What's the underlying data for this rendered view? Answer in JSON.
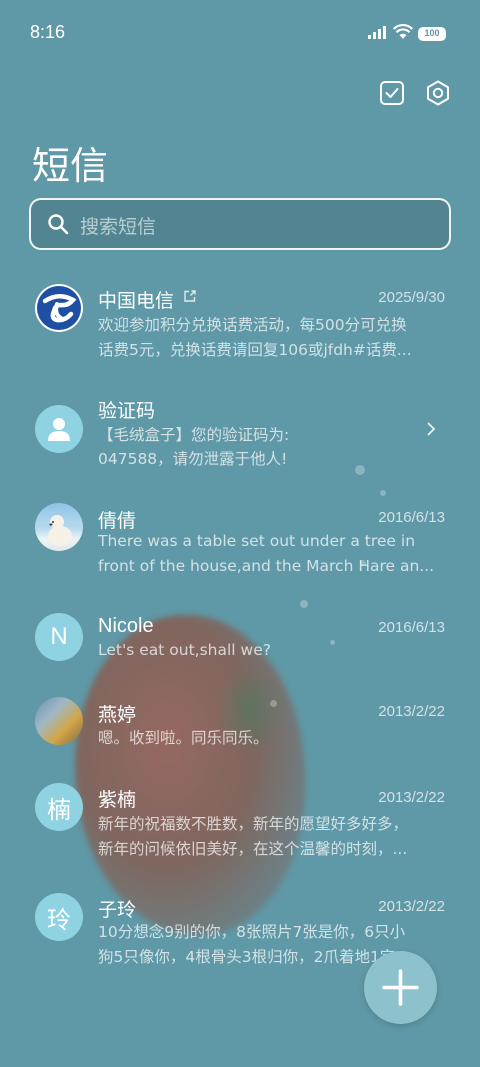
{
  "status_bar": {
    "time": "8:16",
    "battery": "100"
  },
  "header": {
    "title": "短信"
  },
  "search": {
    "placeholder": "搜索短信"
  },
  "conversations": [
    {
      "name": "中国电信",
      "date": "2025/9/30",
      "line1": "欢迎参加积分兑换话费活动，每500分可兑换",
      "line2": "话费5元，兑换话费请回复106或jfdh#话费..."
    },
    {
      "name": "验证码",
      "date": "",
      "line1": "【毛绒盒子】您的验证码为:",
      "line2": "047588，请勿泄露于他人!"
    },
    {
      "name": "倩倩",
      "date": "2016/6/13",
      "line1": "There was a table set out under a tree in",
      "line2": "front of the house,and the March Hare an..."
    },
    {
      "name": "Nicole",
      "avatar_letter": "N",
      "date": "2016/6/13",
      "line1": "Let's eat out,shall we?"
    },
    {
      "name": "燕婷",
      "date": "2013/2/22",
      "line1": "嗯。收到啦。同乐同乐。"
    },
    {
      "name": "紫楠",
      "avatar_letter": "楠",
      "date": "2013/2/22",
      "line1": "新年的祝福数不胜数，新年的愿望好多好多，",
      "line2": "新年的问候依旧美好，在这个温馨的时刻，..."
    },
    {
      "name": "子玲",
      "avatar_letter": "玲",
      "date": "2013/2/22",
      "line1": "10分想念9别的你，8张照片7张是你，6只小",
      "line2": "狗5只像你，4根骨头3根归你，2爪着地1定..."
    }
  ],
  "colors": {
    "background": "#5f98a6",
    "avatar_light": "#8fd3e2",
    "fab": "#8dc2cd",
    "telecom_blue": "#1e4fa3"
  }
}
